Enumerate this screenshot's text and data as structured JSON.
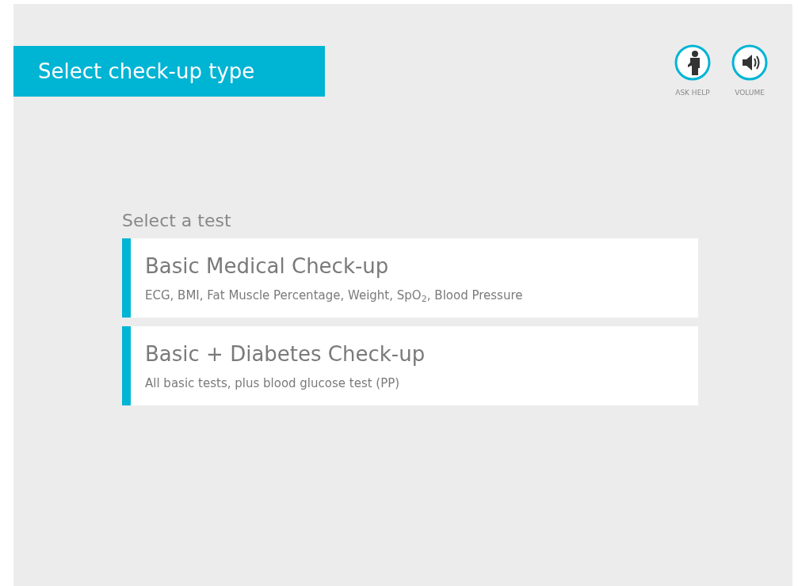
{
  "header": {
    "title": "Select check-up type"
  },
  "actions": [
    {
      "kind": "help",
      "label": "ASK HELP"
    },
    {
      "kind": "volume",
      "label": "VOLUME"
    }
  ],
  "section": {
    "label": "Select a test"
  },
  "tests": [
    {
      "title": "Basic Medical Check-up",
      "description": "ECG, BMI, Fat Muscle Percentage, Weight, SpO$_{2}$, Blood Pressure"
    },
    {
      "title": "Basic + Diabetes Check-up",
      "description": "All basic tests, plus blood glucose test (PP)"
    }
  ]
}
